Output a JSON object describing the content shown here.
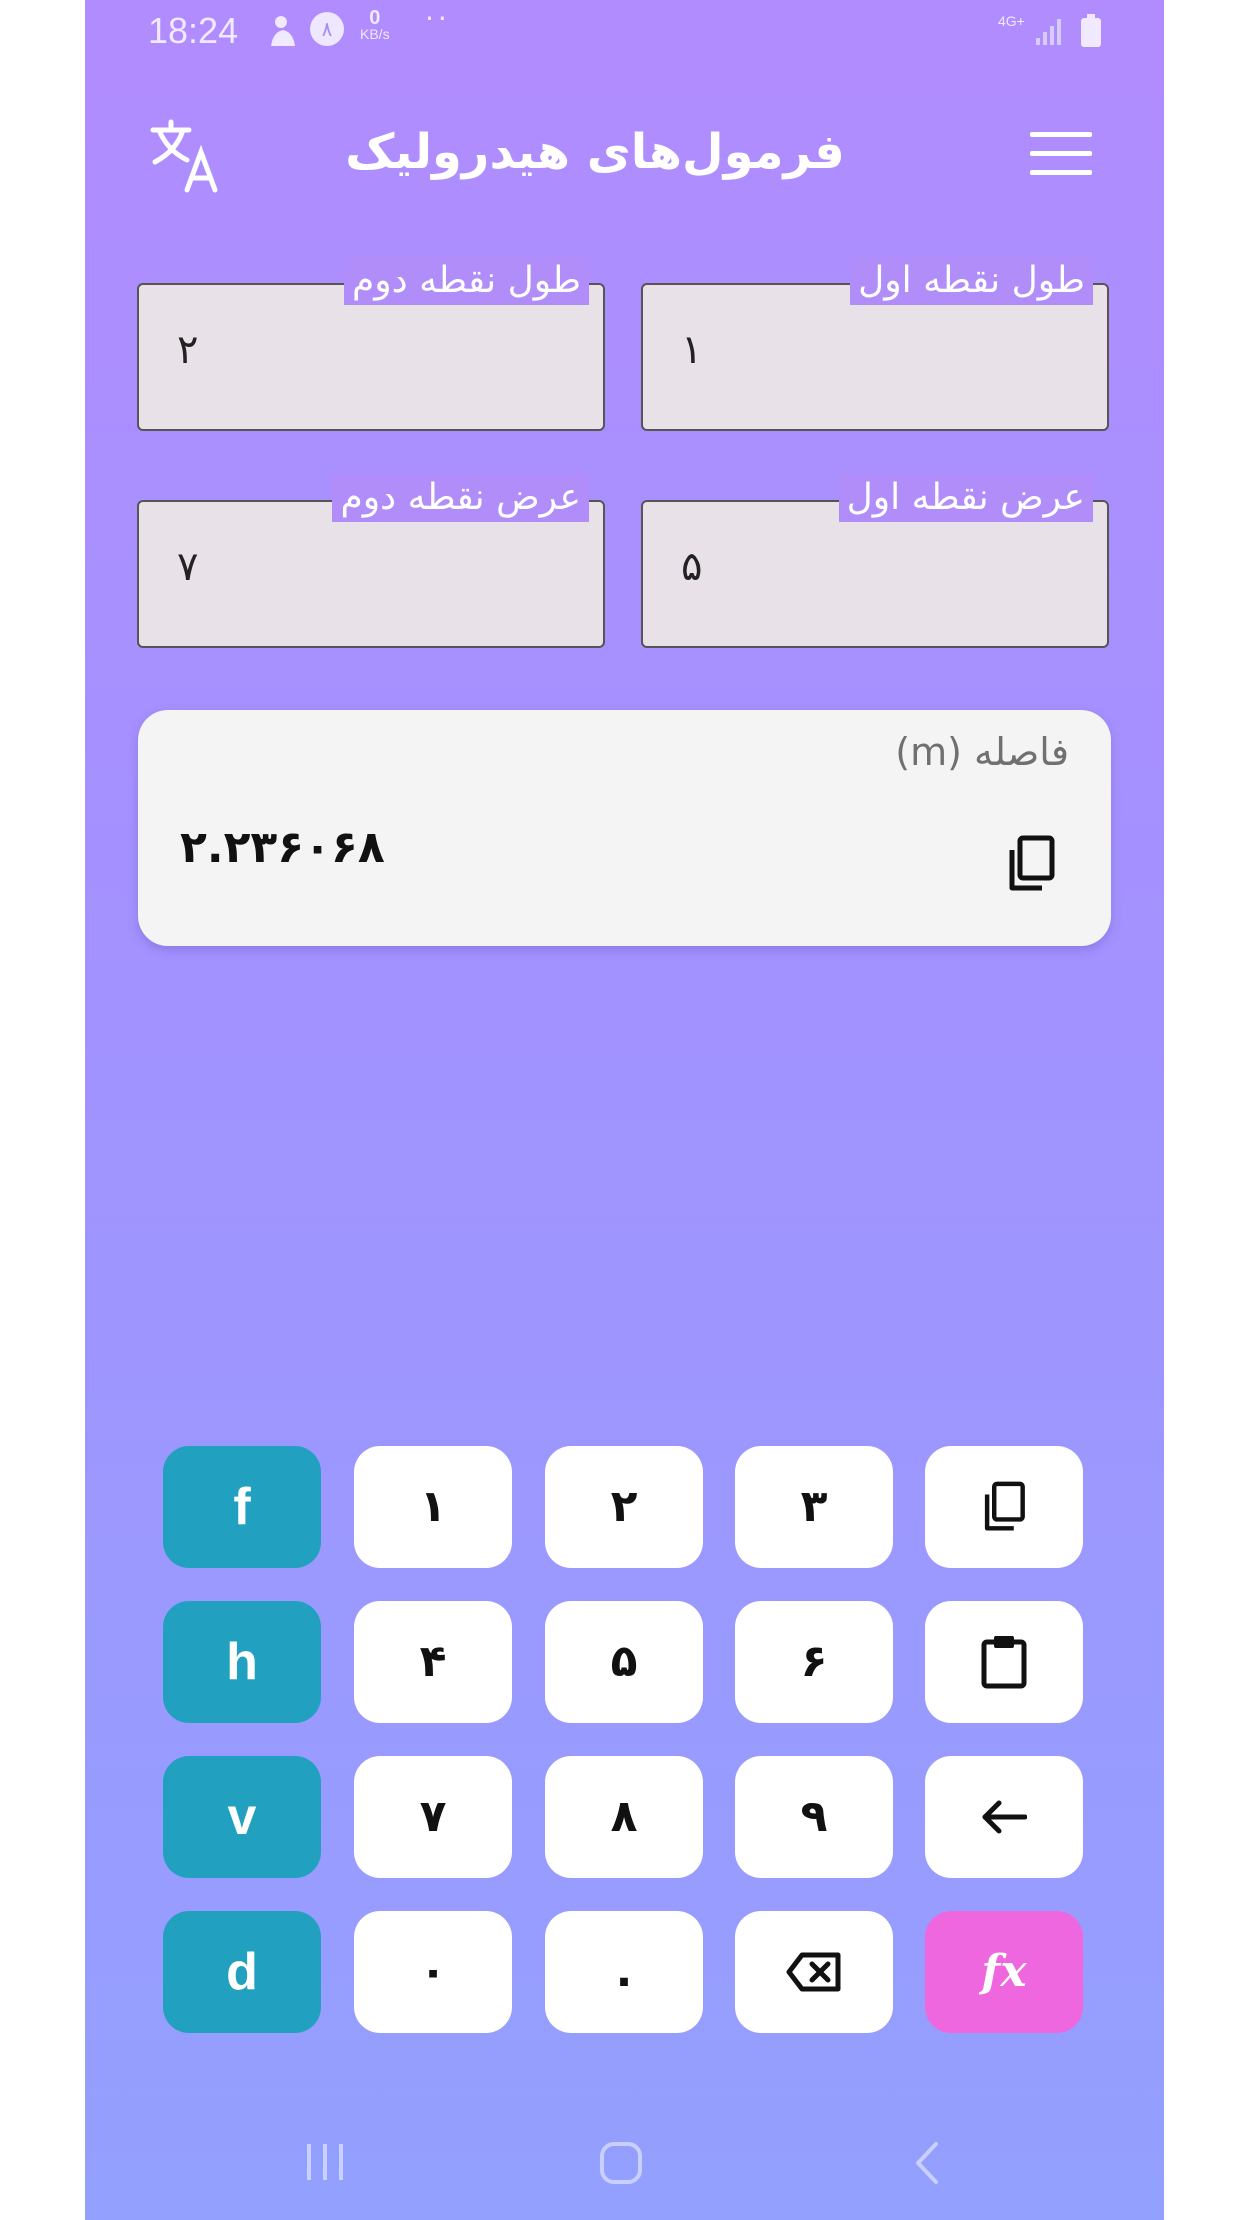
{
  "status_bar": {
    "time": "18:24",
    "notification_badge": "٨",
    "speed_value": "0",
    "speed_unit": "KB/s",
    "dots": "··",
    "network": "4G+"
  },
  "app_bar": {
    "title": "فرمول‌های هیدرولیک",
    "left_icon": "translate-icon",
    "right_icon": "menu-icon"
  },
  "inputs": [
    {
      "label": "طول نقطه دوم",
      "value": "۲"
    },
    {
      "label": "طول نقطه اول",
      "value": "۱"
    },
    {
      "label": "عرض نقطه دوم",
      "value": "۷"
    },
    {
      "label": "عرض نقطه اول",
      "value": "۵"
    }
  ],
  "result": {
    "label": "فاصله (m)",
    "value": "۲.۲۳۶۰۶۸",
    "copy_icon": "copy-icon"
  },
  "keypad": {
    "row1": [
      "f",
      "۱",
      "۲",
      "۳",
      "copy"
    ],
    "row2": [
      "h",
      "۴",
      "۵",
      "۶",
      "paste"
    ],
    "row3": [
      "v",
      "۷",
      "۸",
      "۹",
      "arrow-left"
    ],
    "row4": [
      "d",
      "۰",
      ".",
      "backspace",
      "fx"
    ],
    "fx_label": "fx"
  },
  "colors": {
    "background_top": "#b18cff",
    "background_bottom": "#93a0fd",
    "variable_key": "#22a0bf",
    "fx_key": "#ef67df",
    "field_bg": "#e8e1e8",
    "card_bg": "#f4f4f4"
  },
  "nav_bar": {
    "icons": [
      "recent-apps-icon",
      "home-icon",
      "back-icon"
    ]
  }
}
